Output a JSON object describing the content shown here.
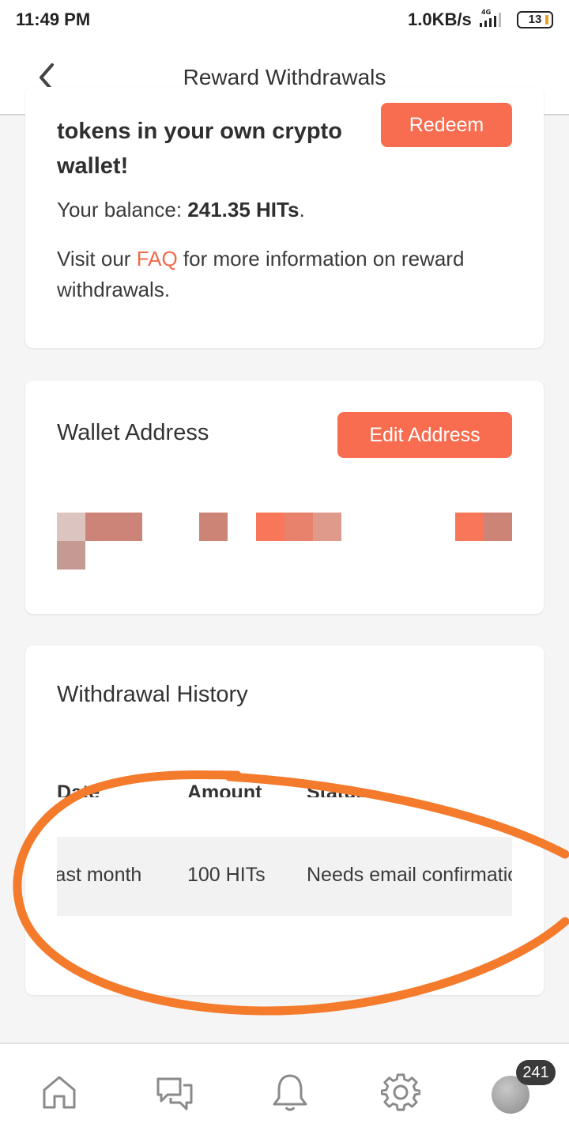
{
  "status_bar": {
    "time": "11:49 PM",
    "net_speed": "1.0KB/s",
    "network_type": "4G",
    "battery": "13"
  },
  "header": {
    "title": "Reward Withdrawals",
    "back_icon": "chevron-left-icon"
  },
  "redeem_card": {
    "headline": "tokens in your own crypto wallet!",
    "redeem_label": "Redeem",
    "balance_prefix": "Your balance: ",
    "balance_value": "241.35 HITs",
    "balance_suffix": ".",
    "faq_prefix": "Visit our ",
    "faq_link": "FAQ",
    "faq_suffix": " for more information on reward withdrawals."
  },
  "wallet_card": {
    "title": "Wallet Address",
    "edit_label": "Edit Address"
  },
  "history_card": {
    "title": "Withdrawal History",
    "columns": [
      "Date",
      "Amount",
      "Status"
    ],
    "rows": [
      {
        "date": "last month",
        "amount": "100 HITs",
        "status": "Needs email confirmation"
      }
    ]
  },
  "bottom_nav": {
    "items": [
      "home-icon",
      "chat-icon",
      "bell-icon",
      "gear-icon",
      "avatar"
    ],
    "badge": "241"
  },
  "colors": {
    "accent": "#f86c4f",
    "annotation_circle": "#f47a2c"
  }
}
